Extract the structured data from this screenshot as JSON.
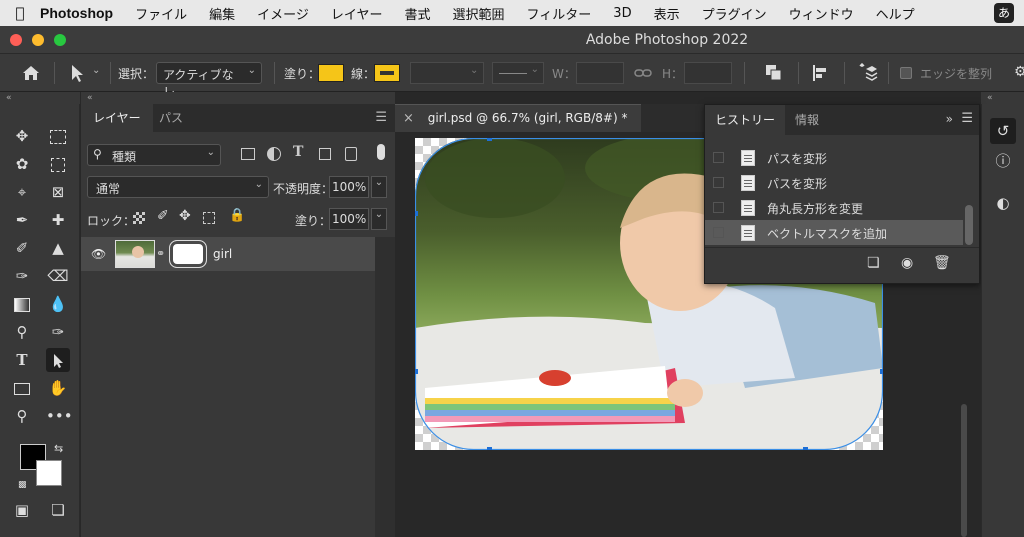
{
  "menubar": {
    "app_name": "Photoshop",
    "items": [
      "ファイル",
      "編集",
      "イメージ",
      "レイヤー",
      "書式",
      "選択範囲",
      "フィルター",
      "3D",
      "表示",
      "プラグイン",
      "ウィンドウ",
      "ヘルプ"
    ],
    "input_mode": "あ"
  },
  "window": {
    "title": "Adobe Photoshop 2022"
  },
  "options_bar": {
    "select_label": "選択：",
    "select_value": "アクティブなレ…",
    "fill_label": "塗り：",
    "fill_color": "#f5c518",
    "stroke_label": "線：",
    "stroke_color": "#f5c518",
    "w_label": "W：",
    "h_label": "H：",
    "align_edges_label": "エッジを整列"
  },
  "layers_panel": {
    "tabs": [
      "レイヤー",
      "パス"
    ],
    "filter_label": "種類",
    "blend_mode": "通常",
    "opacity_label": "不透明度：",
    "opacity_value": "100%",
    "lock_label": "ロック：",
    "fill_label": "塗り：",
    "fill_value": "100%",
    "layer_name": "girl"
  },
  "document": {
    "tab_title": "girl.psd @ 66.7% (girl, RGB/8#) *"
  },
  "history_panel": {
    "tabs": [
      "ヒストリー",
      "情報"
    ],
    "items": [
      "パスを変形",
      "パスを変形",
      "角丸長方形を変更",
      "ベクトルマスクを追加"
    ],
    "selected_index": 3
  }
}
